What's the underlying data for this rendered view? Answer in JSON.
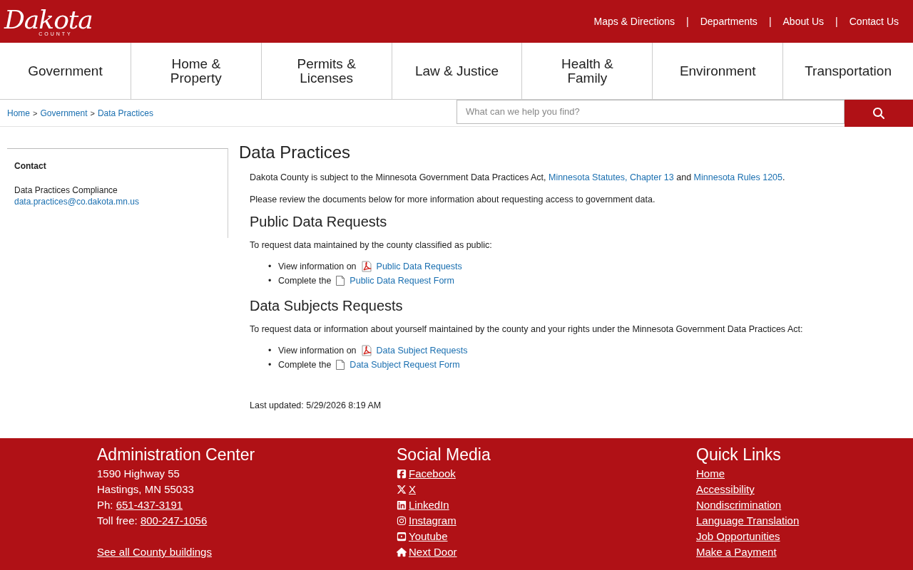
{
  "logo": {
    "name": "Dakota",
    "sub": "COUNTY"
  },
  "top_links": [
    "Maps & Directions",
    "Departments",
    "About Us",
    "Contact Us"
  ],
  "top_separator": "|",
  "breadcrumb_separator": ">",
  "bullet": "•",
  "nav": [
    {
      "label": "Government"
    },
    {
      "label": "Home & Property"
    },
    {
      "label": "Permits & Licenses"
    },
    {
      "label": "Law & Justice"
    },
    {
      "label": "Health & Family"
    },
    {
      "label": "Environment"
    },
    {
      "label": "Transportation"
    }
  ],
  "breadcrumb": [
    "Home",
    "Government",
    "Data Practices"
  ],
  "search": {
    "placeholder": "What can we help you find?"
  },
  "sidebar": {
    "heading": "Contact",
    "name": "Data Practices Compliance",
    "email": "data.practices@co.dakota.mn.us"
  },
  "page_title": "Data Practices",
  "intro": {
    "text": "Dakota County is subject to the Minnesota Government Data Practices Act,",
    "link_1": "Minnesota Statutes, Chapter 13",
    "joiner": "and",
    "link_2": "Minnesota Rules 1205",
    "end": "."
  },
  "intro_2": "Please review the documents below for more information about requesting access to government data.",
  "sections": [
    {
      "heading": "Public Data Requests",
      "text": "To request data maintained by the county classified as public:",
      "items": [
        {
          "prefix": "View information on",
          "kind": "pdf",
          "link": "Public Data Requests"
        },
        {
          "prefix": "Complete the",
          "kind": "doc",
          "link": "Public Data Request Form"
        }
      ]
    },
    {
      "heading": "Data Subjects Requests",
      "text": "To request data or information about yourself maintained by the county and your rights under the Minnesota Government Data Practices Act:",
      "items": [
        {
          "prefix": "View information on",
          "kind": "pdf",
          "link": "Data Subject Requests"
        },
        {
          "prefix": "Complete the",
          "kind": "doc",
          "link": "Data Subject Request Form"
        }
      ]
    }
  ],
  "last_updated": "Last updated: 5/29/2026 8:19 AM",
  "footer": {
    "admin": {
      "heading": "Administration Center",
      "lines": [
        "1590 Highway 55",
        "Hastings, MN 55033"
      ],
      "phone_label": "Ph:",
      "phone": "651-437-3191",
      "tollfree_label": "Toll free:",
      "tollfree": "800-247-1056",
      "more": "See all County buildings"
    },
    "social": {
      "heading": "Social Media",
      "items": [
        {
          "kind": "facebook",
          "label": "Facebook"
        },
        {
          "kind": "x",
          "label": "X"
        },
        {
          "kind": "linkedin",
          "label": "LinkedIn"
        },
        {
          "kind": "instagram",
          "label": "Instagram"
        },
        {
          "kind": "youtube",
          "label": "Youtube"
        },
        {
          "kind": "nextdoor",
          "label": "Next Door"
        }
      ]
    },
    "quick": {
      "heading": "Quick Links",
      "items": [
        "Home",
        "Accessibility",
        "Nondiscrimination",
        "Language Translation",
        "Job Opportunities",
        "Make a Payment"
      ]
    }
  }
}
